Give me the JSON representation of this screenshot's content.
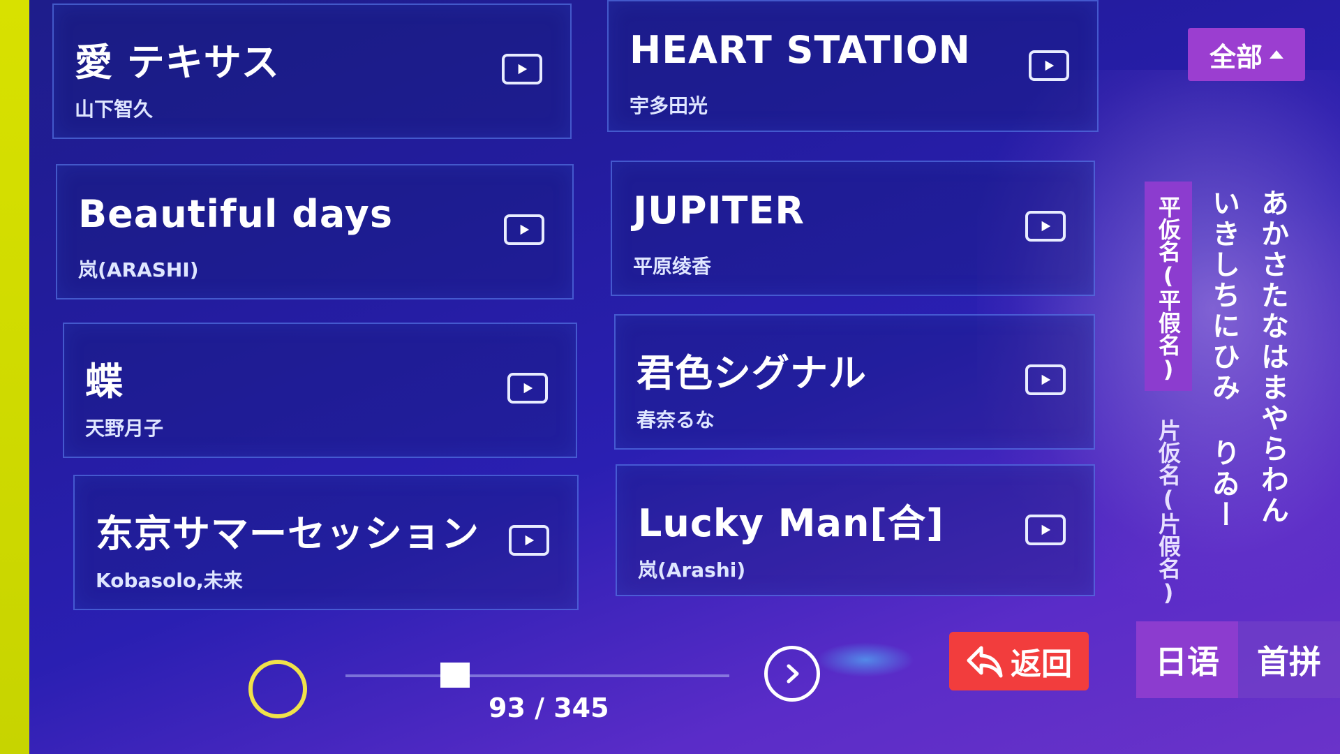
{
  "songs": [
    {
      "title": "愛 テキサス",
      "artist": "山下智久"
    },
    {
      "title": "HEART STATION",
      "artist": "宇多田光"
    },
    {
      "title": "Beautiful days",
      "artist": "岚(ARASHI)"
    },
    {
      "title": "JUPITER",
      "artist": "平原绫香"
    },
    {
      "title": "蝶",
      "artist": "天野月子"
    },
    {
      "title": "君色シグナル",
      "artist": "春奈るな"
    },
    {
      "title": "东京サマーセッション",
      "artist": "Kobasolo,未来"
    },
    {
      "title": "Lucky Man[合]",
      "artist": "岚(Arashi)"
    }
  ],
  "filter": {
    "label": "全部"
  },
  "kana": {
    "tab_hiragana": "平仮名(平假名)",
    "tab_katakana": "片仮名(片假名)",
    "columns": [
      "いきしちにひみ りゐー",
      "あかさたなはまやらわん"
    ]
  },
  "lang_tabs": [
    "日语",
    "首拼"
  ],
  "back_label": "返回",
  "pagination": {
    "text": "93 / 345",
    "current": 93,
    "total": 345
  },
  "colors": {
    "accent_purple": "#8c3ccf",
    "back_red": "#f23d3d",
    "background": "#2a1fb2"
  }
}
